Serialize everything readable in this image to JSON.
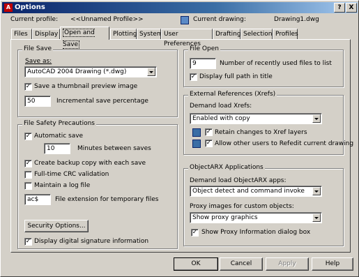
{
  "window": {
    "title": "Options",
    "title_icon": "autocad-icon",
    "help_button": "?",
    "close_button": "X"
  },
  "profile": {
    "label": "Current profile:",
    "value": "<<Unnamed Profile>>",
    "drawing_label": "Current drawing:",
    "drawing_value": "Drawing1.dwg"
  },
  "tabs": [
    "Files",
    "Display",
    "Open and Save",
    "Plotting",
    "System",
    "User Preferences",
    "Drafting",
    "Selection",
    "Profiles"
  ],
  "active_tab": "Open and Save",
  "file_save": {
    "title": "File Save",
    "save_as_label": "Save as:",
    "save_as_value": "AutoCAD 2004 Drawing (*.dwg)",
    "thumbnail_label": "Save a thumbnail preview image",
    "thumbnail_checked": true,
    "incremental_value": "50",
    "incremental_label": "Incremental save percentage"
  },
  "file_safety": {
    "title": "File Safety Precautions",
    "autosave_label": "Automatic save",
    "autosave_checked": true,
    "minutes_value": "10",
    "minutes_label": "Minutes between saves",
    "backup_label": "Create backup copy with each save",
    "backup_checked": true,
    "crc_label": "Full-time CRC validation",
    "crc_checked": false,
    "log_label": "Maintain a log file",
    "log_checked": false,
    "ext_value": "ac$",
    "ext_label": "File extension for temporary files",
    "security_button": "Security Options...",
    "digsig_label": "Display digital signature information",
    "digsig_checked": true
  },
  "file_open": {
    "title": "File Open",
    "recent_value": "9",
    "recent_label": "Number of recently used files to list",
    "fullpath_label": "Display full path in title",
    "fullpath_checked": true
  },
  "xrefs": {
    "title": "External References (Xrefs)",
    "demand_label": "Demand load Xrefs:",
    "demand_value": "Enabled with copy",
    "retain_label": "Retain changes to Xref layers",
    "retain_checked": true,
    "allow_label": "Allow other users to Refedit current drawing",
    "allow_checked": true
  },
  "objectarx": {
    "title": "ObjectARX Applications",
    "demand_label": "Demand load ObjectARX apps:",
    "demand_value": "Object detect and command invoke",
    "proxy_label": "Proxy images for custom objects:",
    "proxy_value": "Show proxy graphics",
    "proxy_dialog_label": "Show Proxy Information dialog box",
    "proxy_dialog_checked": true
  },
  "footer": {
    "ok": "OK",
    "cancel": "Cancel",
    "apply": "Apply",
    "help": "Help"
  }
}
